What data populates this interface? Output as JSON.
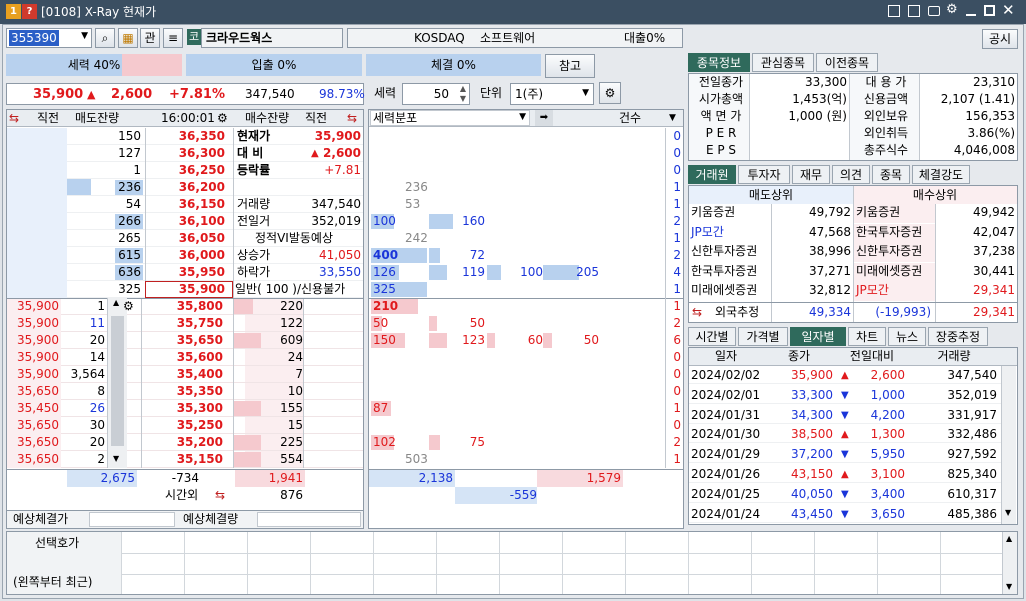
{
  "title": {
    "num1": "1",
    "num2": "?",
    "text": "[0108] X-Ray 현재가",
    "ctrl_icons": [
      "layout-icon",
      "copy-icon",
      "camera-icon",
      "settings-icon",
      "minimize-icon",
      "maximize-icon",
      "close-icon"
    ]
  },
  "toolbar": {
    "code": "355390",
    "gwan": "관",
    "market_badge": "코",
    "stock_name": "크라우드웍스",
    "market": "KOSDAQ",
    "sector": "소프트웨어",
    "loan": "대출0%",
    "notice": "공시"
  },
  "ratio_bar": {
    "force": "세력 40%",
    "loan": "입출 0%",
    "exec": "체결 0%",
    "ref": "참고"
  },
  "price_summary": {
    "price": "35,900",
    "arrow": "▲",
    "change": "2,600",
    "rate": "+7.81%",
    "volume": "347,540",
    "ratio": "98.73%"
  },
  "control": {
    "force_label": "세력",
    "force_value": "50",
    "unit_label": "단위",
    "unit_value": "1(주)"
  },
  "ob_header": {
    "direct_l": "직전",
    "ask_remain": "매도잔량",
    "time": "16:00:01",
    "bid_remain": "매수잔량",
    "direct_r": "직전"
  },
  "asks": [
    {
      "remain": "150",
      "price": "36,350"
    },
    {
      "remain": "127",
      "price": "36,300"
    },
    {
      "remain": "1",
      "price": "36,250"
    },
    {
      "remain": "236",
      "price": "36,200"
    },
    {
      "remain": "54",
      "price": "36,150"
    },
    {
      "remain": "266",
      "price": "36,100"
    },
    {
      "remain": "265",
      "price": "36,050"
    },
    {
      "remain": "615",
      "price": "36,000"
    },
    {
      "remain": "636",
      "price": "35,950"
    },
    {
      "remain": "325",
      "price": "35,900"
    }
  ],
  "bids": [
    {
      "remain": "220",
      "price": "35,800"
    },
    {
      "remain": "122",
      "price": "35,750"
    },
    {
      "remain": "609",
      "price": "35,650"
    },
    {
      "remain": "24",
      "price": "35,600"
    },
    {
      "remain": "7",
      "price": "35,400"
    },
    {
      "remain": "10",
      "price": "35,350"
    },
    {
      "remain": "155",
      "price": "35,300"
    },
    {
      "remain": "15",
      "price": "35,250"
    },
    {
      "remain": "225",
      "price": "35,200"
    },
    {
      "remain": "554",
      "price": "35,150"
    }
  ],
  "ticks": [
    {
      "p": "35,900",
      "q": "1"
    },
    {
      "p": "35,900",
      "q": "11"
    },
    {
      "p": "35,900",
      "q": "20"
    },
    {
      "p": "35,900",
      "q": "14"
    },
    {
      "p": "35,900",
      "q": "3,564"
    },
    {
      "p": "35,650",
      "q": "8"
    },
    {
      "p": "35,450",
      "q": "26"
    },
    {
      "p": "35,650",
      "q": "30"
    },
    {
      "p": "35,650",
      "q": "20"
    },
    {
      "p": "35,650",
      "q": "2"
    }
  ],
  "info": {
    "cur_label": "현재가",
    "cur": "35,900",
    "chg_label": "대 비",
    "chg_arrow": "▲",
    "chg": "2,600",
    "rate_label": "등락률",
    "rate": "+7.81",
    "vol_label": "거래량",
    "vol": "347,540",
    "prev_label": "전일거",
    "prev": "352,019",
    "vi": "정적VI발동예상",
    "up_label": "상승가",
    "up": "41,050",
    "down_label": "하락가",
    "down": "33,550",
    "misc": "일반( 100 )/신용불가"
  },
  "ob_totals": {
    "ask_total": "2,675",
    "diff": "-734",
    "bid_total": "1,941",
    "after_label": "시간외",
    "after": "876"
  },
  "expected": {
    "price_label": "예상체결가",
    "vol_label": "예상체결량"
  },
  "dist": {
    "header": "세력분포",
    "count_header": "건수",
    "rows": [
      {
        "v": [],
        "n": "0"
      },
      {
        "v": [],
        "n": "0"
      },
      {
        "v": [],
        "n": "0"
      },
      {
        "v": [
          "236"
        ],
        "n": "1"
      },
      {
        "v": [
          "53"
        ],
        "n": "1"
      },
      {
        "v": [
          "100",
          "160"
        ],
        "n": "2"
      },
      {
        "v": [
          "242"
        ],
        "n": "1"
      },
      {
        "v": [
          "400",
          "72"
        ],
        "n": "2"
      },
      {
        "v": [
          "126",
          "119",
          "100",
          "205"
        ],
        "n": "4"
      },
      {
        "v": [
          "325"
        ],
        "n": "1"
      },
      {
        "v": [
          "210"
        ],
        "n": "1"
      },
      {
        "v": [
          "50",
          "50"
        ],
        "n": "2"
      },
      {
        "v": [
          "150",
          "123",
          "60",
          "50"
        ],
        "n": "6"
      },
      {
        "v": [],
        "n": "0"
      },
      {
        "v": [],
        "n": "0"
      },
      {
        "v": [],
        "n": "0"
      },
      {
        "v": [
          "87"
        ],
        "n": "1"
      },
      {
        "v": [],
        "n": "0"
      },
      {
        "v": [
          "102",
          "75"
        ],
        "n": "2"
      },
      {
        "v": [
          "503"
        ],
        "n": "1"
      }
    ],
    "total_left": "2,138",
    "total_right": "1,579",
    "net": "-559"
  },
  "right_tabs": [
    "종목정보",
    "관심종목",
    "이전종목"
  ],
  "stock_info": {
    "left": [
      {
        "k": "전일종가",
        "v": "33,300"
      },
      {
        "k": "시가총액",
        "v": "1,453(억)"
      },
      {
        "k": "액 면 가",
        "v": "1,000 (원)"
      },
      {
        "k": "P E R",
        "v": ""
      },
      {
        "k": "E P S",
        "v": ""
      }
    ],
    "right": [
      {
        "k": "대 용 가",
        "v": "23,310"
      },
      {
        "k": "신용금액",
        "v": "2,107  (1.41)"
      },
      {
        "k": "외인보유",
        "v": "156,353"
      },
      {
        "k": "외인취득",
        "v": "3.86(%)"
      },
      {
        "k": "총주식수",
        "v": "4,046,008"
      }
    ]
  },
  "broker_tabs": [
    "거래원",
    "투자자",
    "재무",
    "의견",
    "종목",
    "체결강도"
  ],
  "broker": {
    "sell_header": "매도상위",
    "buy_header": "매수상위",
    "sell": [
      {
        "n": "키움증권",
        "v": "49,792",
        "c": "k"
      },
      {
        "n": "JP모간",
        "v": "47,568",
        "c": "b"
      },
      {
        "n": "신한투자증권",
        "v": "38,996",
        "c": "k"
      },
      {
        "n": "한국투자증권",
        "v": "37,271",
        "c": "k"
      },
      {
        "n": "미래에셋증권",
        "v": "32,812",
        "c": "k"
      }
    ],
    "buy": [
      {
        "n": "키움증권",
        "v": "49,942",
        "c": "k"
      },
      {
        "n": "한국투자증권",
        "v": "42,047",
        "c": "k"
      },
      {
        "n": "신한투자증권",
        "v": "37,238",
        "c": "k"
      },
      {
        "n": "미래에셋증권",
        "v": "30,441",
        "c": "k"
      },
      {
        "n": "JP모간",
        "v": "29,341",
        "c": "r"
      }
    ],
    "foreign_label": "외국추정",
    "foreign_sell": "49,334",
    "foreign_diff": "(-19,993)",
    "foreign_buy": "29,341"
  },
  "daily_tabs": [
    "시간별",
    "가격별",
    "일자별",
    "차트",
    "뉴스",
    "장중추정"
  ],
  "daily": {
    "headers": [
      "일자",
      "종가",
      "전일대비",
      "거래량"
    ],
    "rows": [
      {
        "d": "2024/02/02",
        "c": "35,900",
        "cc": "r",
        "a": "▲",
        "ch": "2,600",
        "v": "347,540"
      },
      {
        "d": "2024/02/01",
        "c": "33,300",
        "cc": "b",
        "a": "▼",
        "ch": "1,000",
        "v": "352,019"
      },
      {
        "d": "2024/01/31",
        "c": "34,300",
        "cc": "b",
        "a": "▼",
        "ch": "4,200",
        "v": "331,917"
      },
      {
        "d": "2024/01/30",
        "c": "38,500",
        "cc": "r",
        "a": "▲",
        "ch": "1,300",
        "v": "332,486"
      },
      {
        "d": "2024/01/29",
        "c": "37,200",
        "cc": "b",
        "a": "▼",
        "ch": "5,950",
        "v": "927,592"
      },
      {
        "d": "2024/01/26",
        "c": "43,150",
        "cc": "r",
        "a": "▲",
        "ch": "3,100",
        "v": "825,340"
      },
      {
        "d": "2024/01/25",
        "c": "40,050",
        "cc": "b",
        "a": "▼",
        "ch": "3,400",
        "v": "610,317"
      },
      {
        "d": "2024/01/24",
        "c": "43,450",
        "cc": "b",
        "a": "▼",
        "ch": "3,650",
        "v": "485,386"
      }
    ]
  },
  "bottom": {
    "sel_label": "선택호가",
    "recent_label": "(왼쪽부터 최근)"
  },
  "colors": {
    "up": "#e0191c",
    "down": "#1a35d9",
    "title_bg": "#3b4f62",
    "tab_on": "#2f6a5c",
    "ask_bg": "#e8f0fb",
    "bid_bg": "#fbeef0"
  }
}
